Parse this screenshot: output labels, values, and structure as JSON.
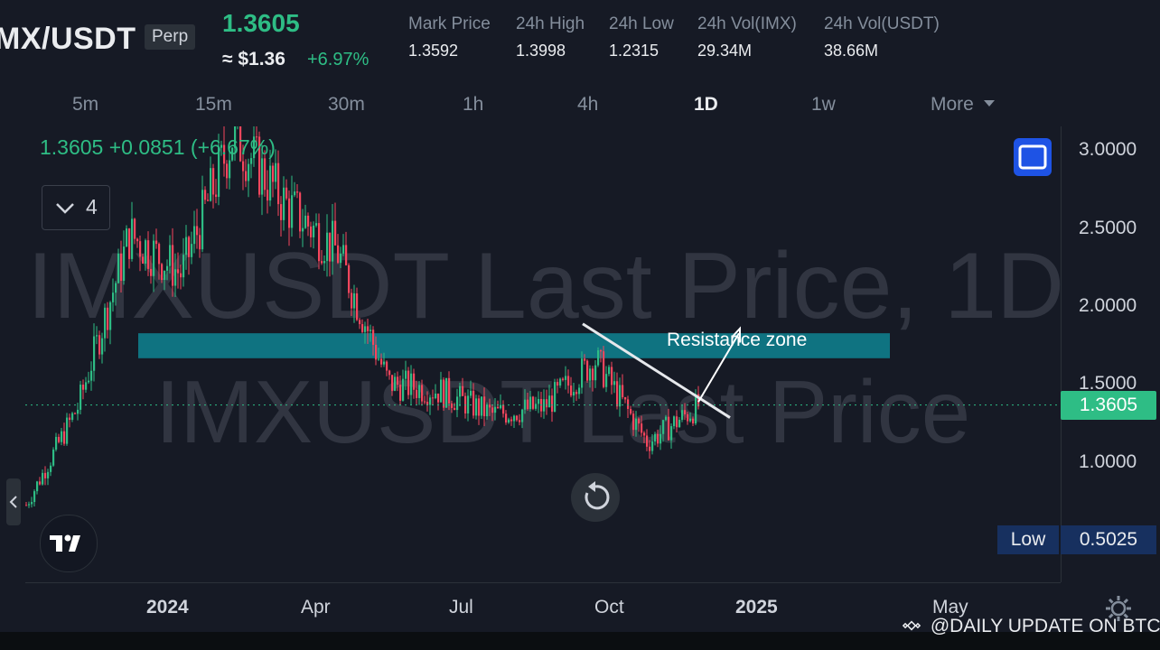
{
  "header": {
    "pair": "MX/USDT",
    "perp": "Perp",
    "last_price": "1.3605",
    "usd_price": "≈ $1.36",
    "change_pct": "+6.97%",
    "stats": [
      {
        "label": "Mark Price",
        "value": "1.3592"
      },
      {
        "label": "24h High",
        "value": "1.3998"
      },
      {
        "label": "24h Low",
        "value": "1.2315"
      },
      {
        "label": "24h Vol(IMX)",
        "value": "29.34M"
      },
      {
        "label": "24h Vol(USDT)",
        "value": "38.66M"
      }
    ]
  },
  "timeframes": {
    "items": [
      "5m",
      "15m",
      "30m",
      "1h",
      "4h",
      "1D",
      "1w",
      "More"
    ],
    "active": "1D"
  },
  "chart": {
    "ohlc_readout": "1.3605 +0.0851 (+6.67%)",
    "indicator_count": "4",
    "watermark_line1": "IMXUSDT Last Price, 1D",
    "watermark_line2": "IMXUSDT Last Price",
    "annotation": "Resistance zone",
    "current_price_tag": "1.3605",
    "low_label": "Low",
    "low_value": "0.5025",
    "y_ticks": [
      "3.0000",
      "2.5000",
      "2.0000",
      "1.5000",
      "1.0000"
    ],
    "x_ticks": [
      "2024",
      "Apr",
      "Jul",
      "Oct",
      "2025",
      "May"
    ],
    "source_watermark": "@DAILY UPDATE ON BTC"
  },
  "colors": {
    "up": "#2ebd85",
    "down": "#f6465d",
    "zone": "#0e7d8c",
    "background": "#161a25",
    "accent_blue": "#1e53e5"
  },
  "chart_data": {
    "type": "candlestick",
    "symbol": "IMXUSDT",
    "interval": "1D",
    "ylim": [
      0.5,
      3.0
    ],
    "y_ticks": [
      3.0,
      2.5,
      2.0,
      1.5,
      1.0
    ],
    "x_ticks": [
      "2024",
      "Apr",
      "Jul",
      "Oct",
      "2025",
      "May"
    ],
    "current_price": 1.3605,
    "low": 0.5025,
    "resistance_zone": [
      1.66,
      1.82
    ],
    "trendline": [
      {
        "month": "late Sep 2024",
        "price": 1.88
      },
      {
        "month": "early Dec 2024",
        "price": 1.28
      }
    ],
    "close_path": [
      {
        "t": "Nov 2023",
        "price": 0.72
      },
      {
        "t": "Dec 2023",
        "price": 1.35
      },
      {
        "t": "Jan 2024",
        "price": 2.45
      },
      {
        "t": "Feb 2024",
        "price": 2.2
      },
      {
        "t": "Mar 2024",
        "price": 3.1
      },
      {
        "t": "Apr 2024",
        "price": 2.65
      },
      {
        "t": "May 2024",
        "price": 2.35
      },
      {
        "t": "Jun 2024",
        "price": 1.5
      },
      {
        "t": "Jul 2024",
        "price": 1.45
      },
      {
        "t": "Aug 2024",
        "price": 1.3
      },
      {
        "t": "Sep 2024",
        "price": 1.35
      },
      {
        "t": "Oct 2024",
        "price": 1.65
      },
      {
        "t": "Nov 2024",
        "price": 1.12
      },
      {
        "t": "Dec 2024",
        "price": 1.36
      }
    ]
  }
}
